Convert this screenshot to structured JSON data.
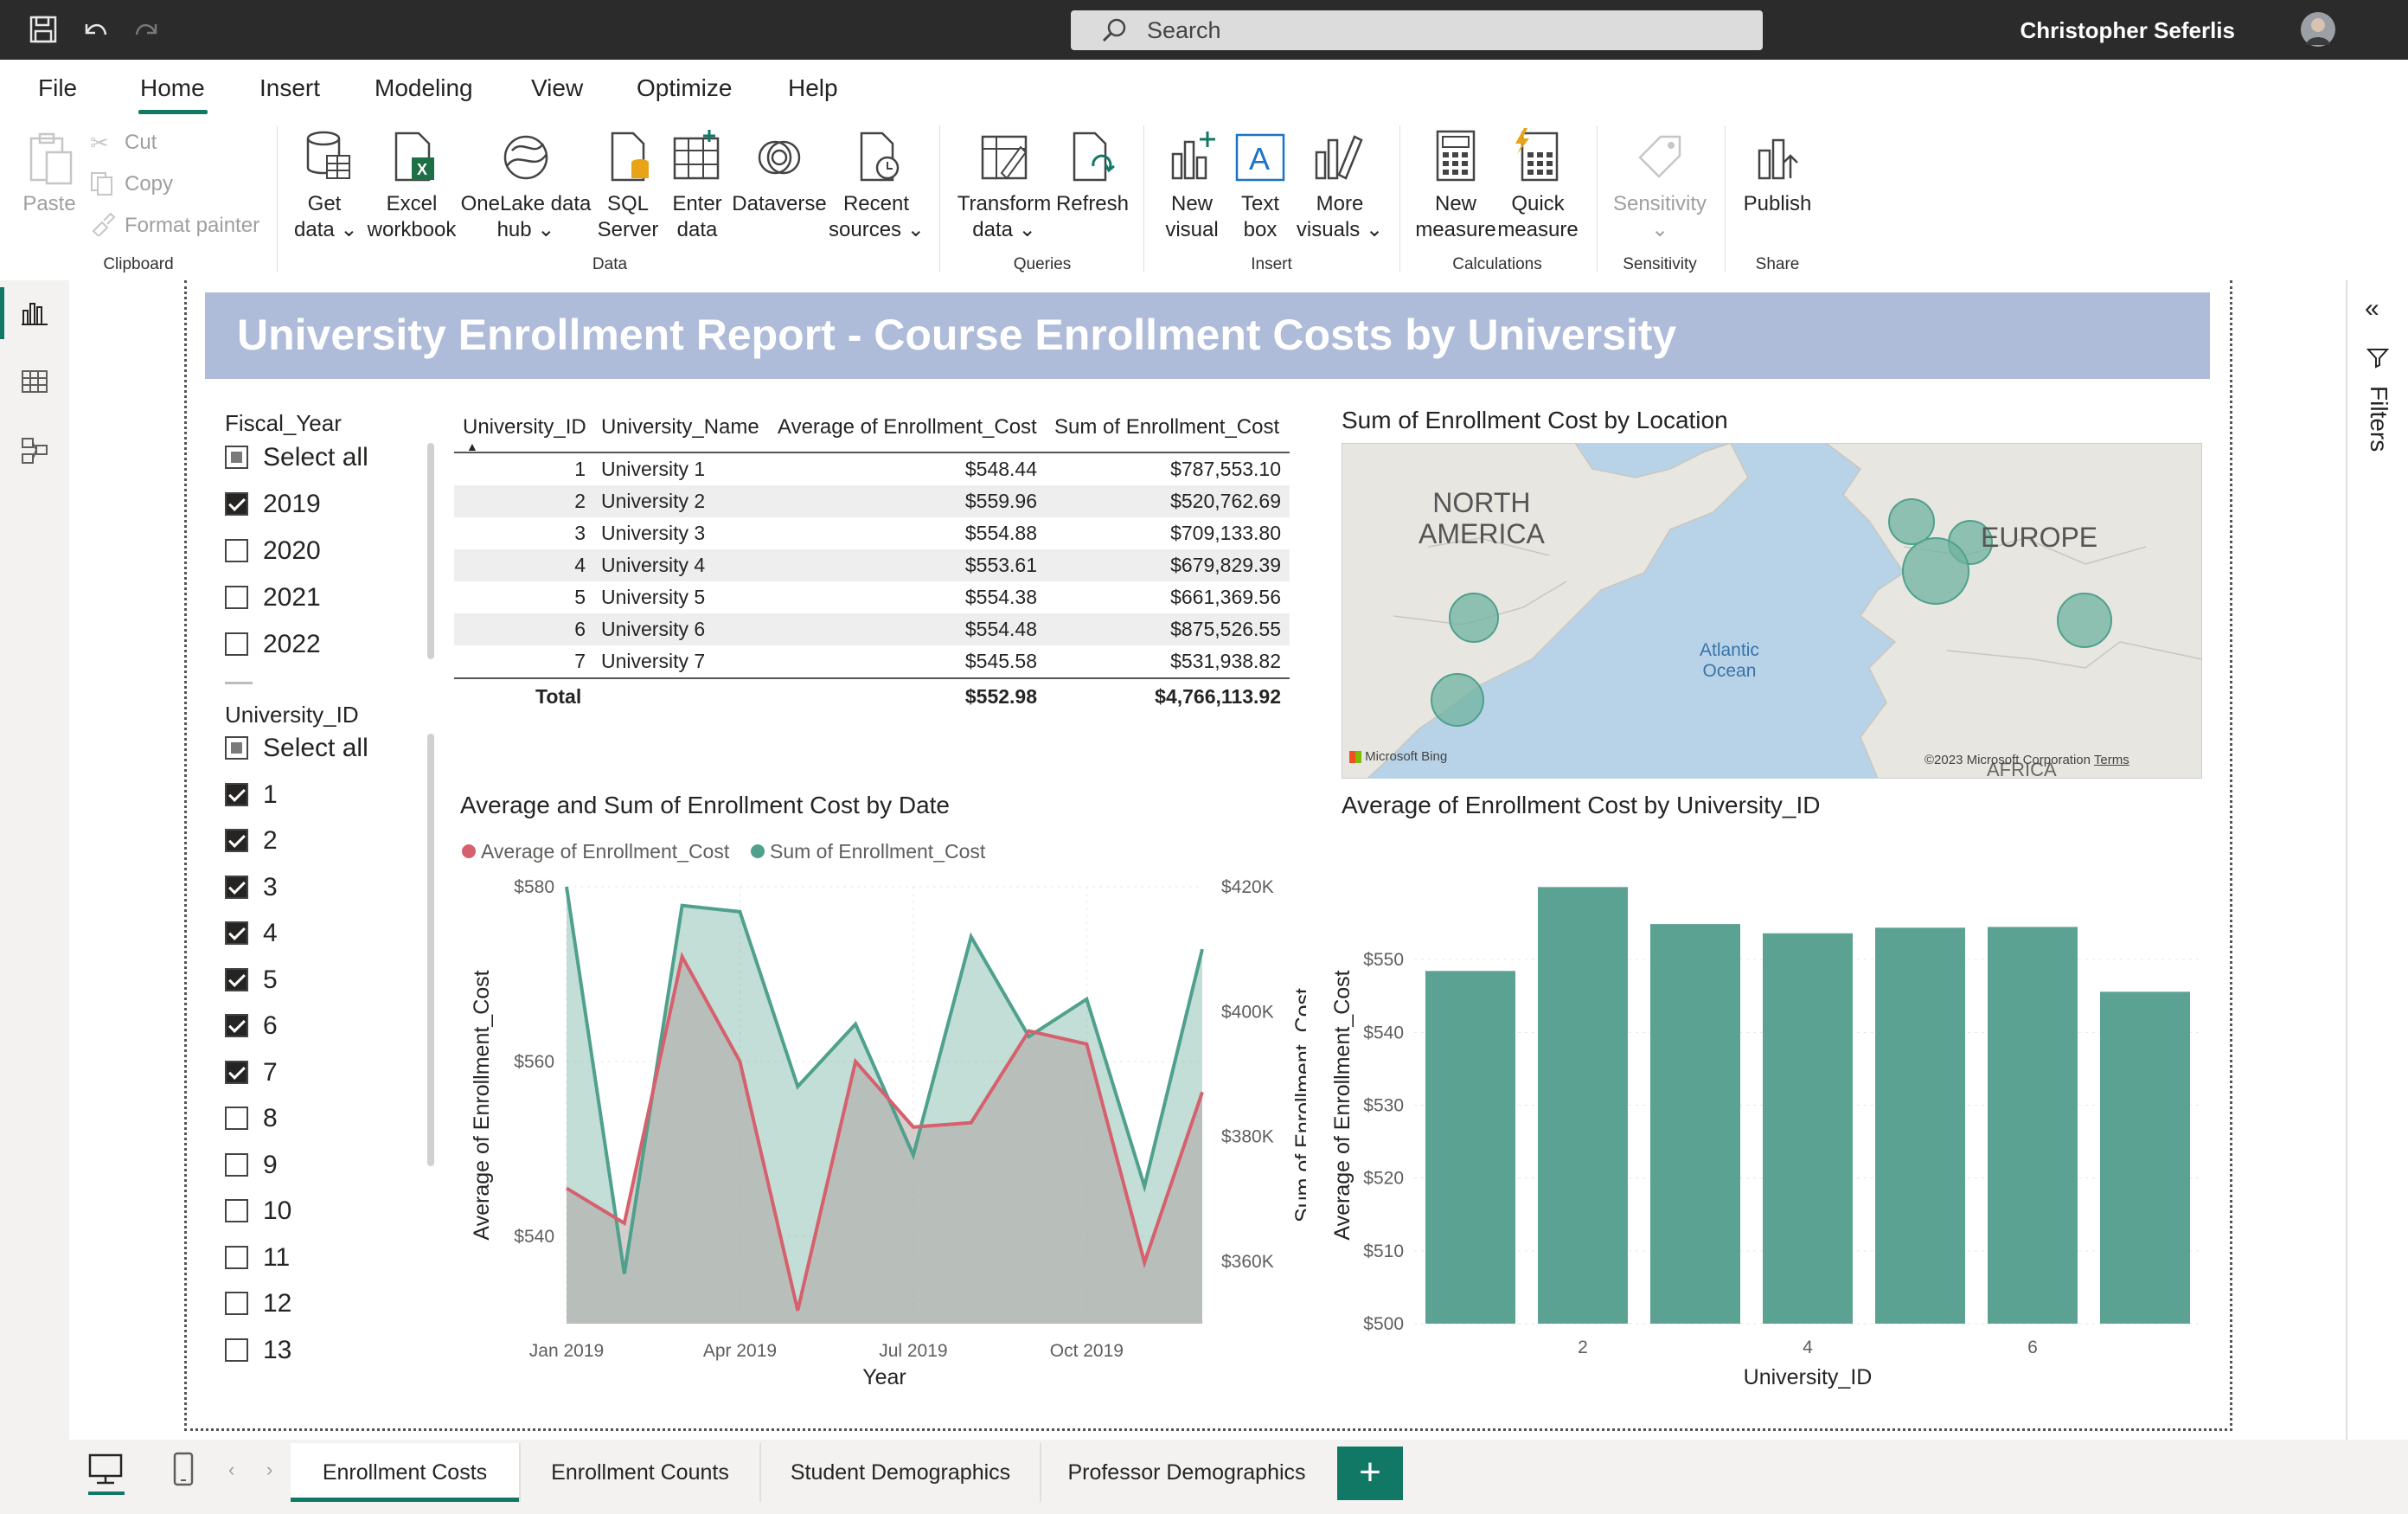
{
  "titlebar": {
    "search_placeholder": "Search",
    "user_name": "Christopher Seferlis",
    "icons": [
      "save-icon",
      "undo-icon",
      "redo-icon"
    ]
  },
  "menu": [
    "File",
    "Home",
    "Insert",
    "Modeling",
    "View",
    "Optimize",
    "Help"
  ],
  "ribbon": {
    "clipboard": {
      "paste": "Paste",
      "cut": "Cut",
      "copy": "Copy",
      "format_painter": "Format painter",
      "group": "Clipboard"
    },
    "data": {
      "get_data": [
        "Get",
        "data"
      ],
      "excel": [
        "Excel",
        "workbook"
      ],
      "onelake": [
        "OneLake data",
        "hub"
      ],
      "sql": [
        "SQL",
        "Server"
      ],
      "enter": [
        "Enter",
        "data"
      ],
      "dataverse": "Dataverse",
      "recent": [
        "Recent",
        "sources"
      ],
      "group": "Data"
    },
    "queries": {
      "transform": [
        "Transform",
        "data"
      ],
      "refresh": "Refresh",
      "group": "Queries"
    },
    "insert": {
      "new_visual": [
        "New",
        "visual"
      ],
      "text_box": [
        "Text",
        "box"
      ],
      "more_visuals": [
        "More",
        "visuals"
      ],
      "group": "Insert"
    },
    "calculations": {
      "new_measure": [
        "New",
        "measure"
      ],
      "quick_measure": [
        "Quick",
        "measure"
      ],
      "group": "Calculations"
    },
    "sensitivity": {
      "label": "Sensitivity",
      "group": "Sensitivity"
    },
    "share": {
      "publish": "Publish",
      "group": "Share"
    }
  },
  "report": {
    "title": "University Enrollment Report - Course Enrollment Costs by University",
    "fiscal_slicer": {
      "title": "Fiscal_Year",
      "items": [
        {
          "label": "Select all",
          "state": "partial"
        },
        {
          "label": "2019",
          "state": "checked"
        },
        {
          "label": "2020",
          "state": "unchecked"
        },
        {
          "label": "2021",
          "state": "unchecked"
        },
        {
          "label": "2022",
          "state": "unchecked"
        }
      ]
    },
    "university_slicer": {
      "title": "University_ID",
      "items": [
        {
          "label": "Select all",
          "state": "partial"
        },
        {
          "label": "1",
          "state": "checked"
        },
        {
          "label": "2",
          "state": "checked"
        },
        {
          "label": "3",
          "state": "checked"
        },
        {
          "label": "4",
          "state": "checked"
        },
        {
          "label": "5",
          "state": "checked"
        },
        {
          "label": "6",
          "state": "checked"
        },
        {
          "label": "7",
          "state": "checked"
        },
        {
          "label": "8",
          "state": "unchecked"
        },
        {
          "label": "9",
          "state": "unchecked"
        },
        {
          "label": "10",
          "state": "unchecked"
        },
        {
          "label": "11",
          "state": "unchecked"
        },
        {
          "label": "12",
          "state": "unchecked"
        },
        {
          "label": "13",
          "state": "unchecked"
        }
      ]
    },
    "table": {
      "headers": [
        "University_ID",
        "University_Name",
        "Average of Enrollment_Cost",
        "Sum of Enrollment_Cost"
      ],
      "rows": [
        [
          "1",
          "University 1",
          "$548.44",
          "$787,553.10"
        ],
        [
          "2",
          "University 2",
          "$559.96",
          "$520,762.69"
        ],
        [
          "3",
          "University 3",
          "$554.88",
          "$709,133.80"
        ],
        [
          "4",
          "University 4",
          "$553.61",
          "$679,829.39"
        ],
        [
          "5",
          "University 5",
          "$554.38",
          "$661,369.56"
        ],
        [
          "6",
          "University 6",
          "$554.48",
          "$875,526.55"
        ],
        [
          "7",
          "University 7",
          "$545.58",
          "$531,938.82"
        ]
      ],
      "total": [
        "Total",
        "",
        "$552.98",
        "$4,766,113.92"
      ]
    },
    "map": {
      "title": "Sum of Enrollment Cost by Location",
      "labels": {
        "na": [
          "NORTH",
          "AMERICA"
        ],
        "eu": "EUROPE",
        "ocean": [
          "Atlantic",
          "Ocean"
        ],
        "af": "AFRICA"
      },
      "bing": "Microsoft Bing",
      "copyright": "©2023 Microsoft Corporation",
      "terms": "Terms"
    }
  },
  "chart_data": [
    {
      "type": "area",
      "title": "Average and Sum of Enrollment Cost by Date",
      "xlabel": "Year",
      "ylabel": "Average of Enrollment_Cost",
      "y2label": "Sum of Enrollment_Cost",
      "x_ticks": [
        "Jan 2019",
        "Apr 2019",
        "Jul 2019",
        "Oct 2019"
      ],
      "y_ticks": [
        "$540",
        "$560",
        "$580"
      ],
      "y2_ticks": [
        "$360K",
        "$380K",
        "$400K",
        "$420K"
      ],
      "ylim": [
        530,
        580
      ],
      "y2lim": [
        350,
        420
      ],
      "x": [
        "2019-01",
        "2019-02",
        "2019-03",
        "2019-04",
        "2019-05",
        "2019-06",
        "2019-07",
        "2019-08",
        "2019-09",
        "2019-10",
        "2019-11",
        "2019-12"
      ],
      "series": [
        {
          "name": "Average of Enrollment_Cost",
          "axis": "left",
          "color": "#d6606d",
          "values": [
            545.5,
            541.5,
            572,
            560,
            531.5,
            560,
            552.5,
            553,
            563.5,
            562,
            537,
            556.5
          ]
        },
        {
          "name": "Sum of Enrollment_Cost",
          "axis": "right",
          "color": "#4fa08c",
          "values": [
            420,
            358,
            417,
            416,
            388,
            398,
            377,
            412,
            396,
            402,
            372,
            410
          ]
        }
      ]
    },
    {
      "type": "bar",
      "title": "Average of Enrollment Cost by University_ID",
      "xlabel": "University_ID",
      "ylabel": "Average of Enrollment_Cost",
      "categories": [
        "1",
        "2",
        "3",
        "4",
        "5",
        "6",
        "7"
      ],
      "x_tick_labels": [
        "",
        "2",
        "",
        "4",
        "",
        "6",
        ""
      ],
      "y_ticks": [
        "$500",
        "$510",
        "$520",
        "$530",
        "$540",
        "$550"
      ],
      "values": [
        548.44,
        559.96,
        554.88,
        553.61,
        554.38,
        554.48,
        545.58
      ],
      "ylim": [
        500,
        560
      ],
      "color": "#5ba292"
    }
  ],
  "tabs": [
    "Enrollment Costs",
    "Enrollment Counts",
    "Student Demographics",
    "Professor Demographics"
  ],
  "filters_label": "Filters"
}
